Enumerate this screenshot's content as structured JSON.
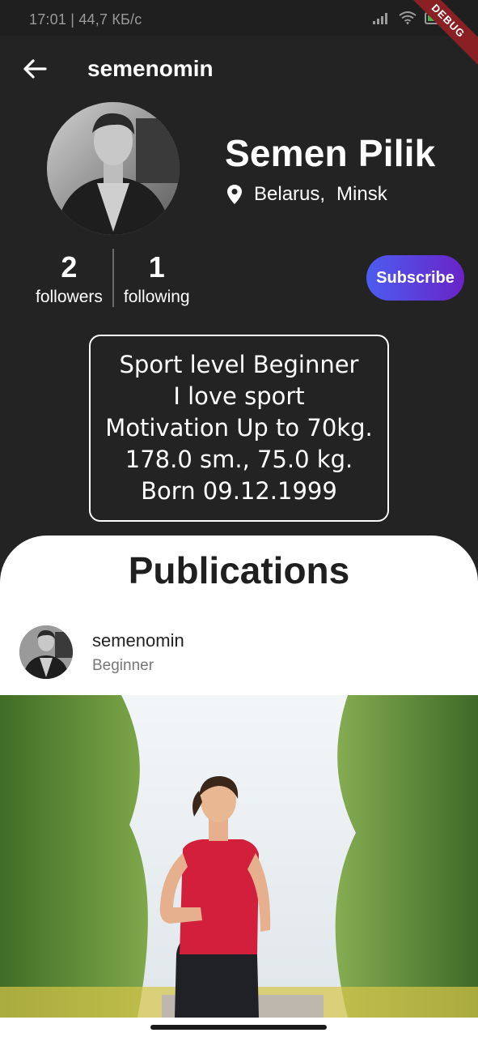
{
  "status": {
    "time": "17:01 | 44,7 КБ/с",
    "debug": "DEBUG"
  },
  "appbar": {
    "username": "semenomin"
  },
  "profile": {
    "name": "Semen Pilik",
    "country": "Belarus,",
    "city": "Minsk",
    "followers": {
      "count": "2",
      "label": "followers"
    },
    "following": {
      "count": "1",
      "label": "following"
    },
    "subscribe_label": "Subscribe"
  },
  "bio": {
    "lines": [
      "Sport level Beginner",
      "I love sport",
      "Motivation Up to 70kg.",
      "178.0 sm., 75.0 kg.",
      "Born 09.12.1999"
    ]
  },
  "publications": {
    "title": "Publications",
    "post": {
      "username": "semenomin",
      "level": "Beginner"
    }
  },
  "colors": {
    "background": "#232323",
    "subscribe_start": "#4b5df0",
    "subscribe_end": "#6a23c7",
    "debug_banner": "#8b2024"
  }
}
